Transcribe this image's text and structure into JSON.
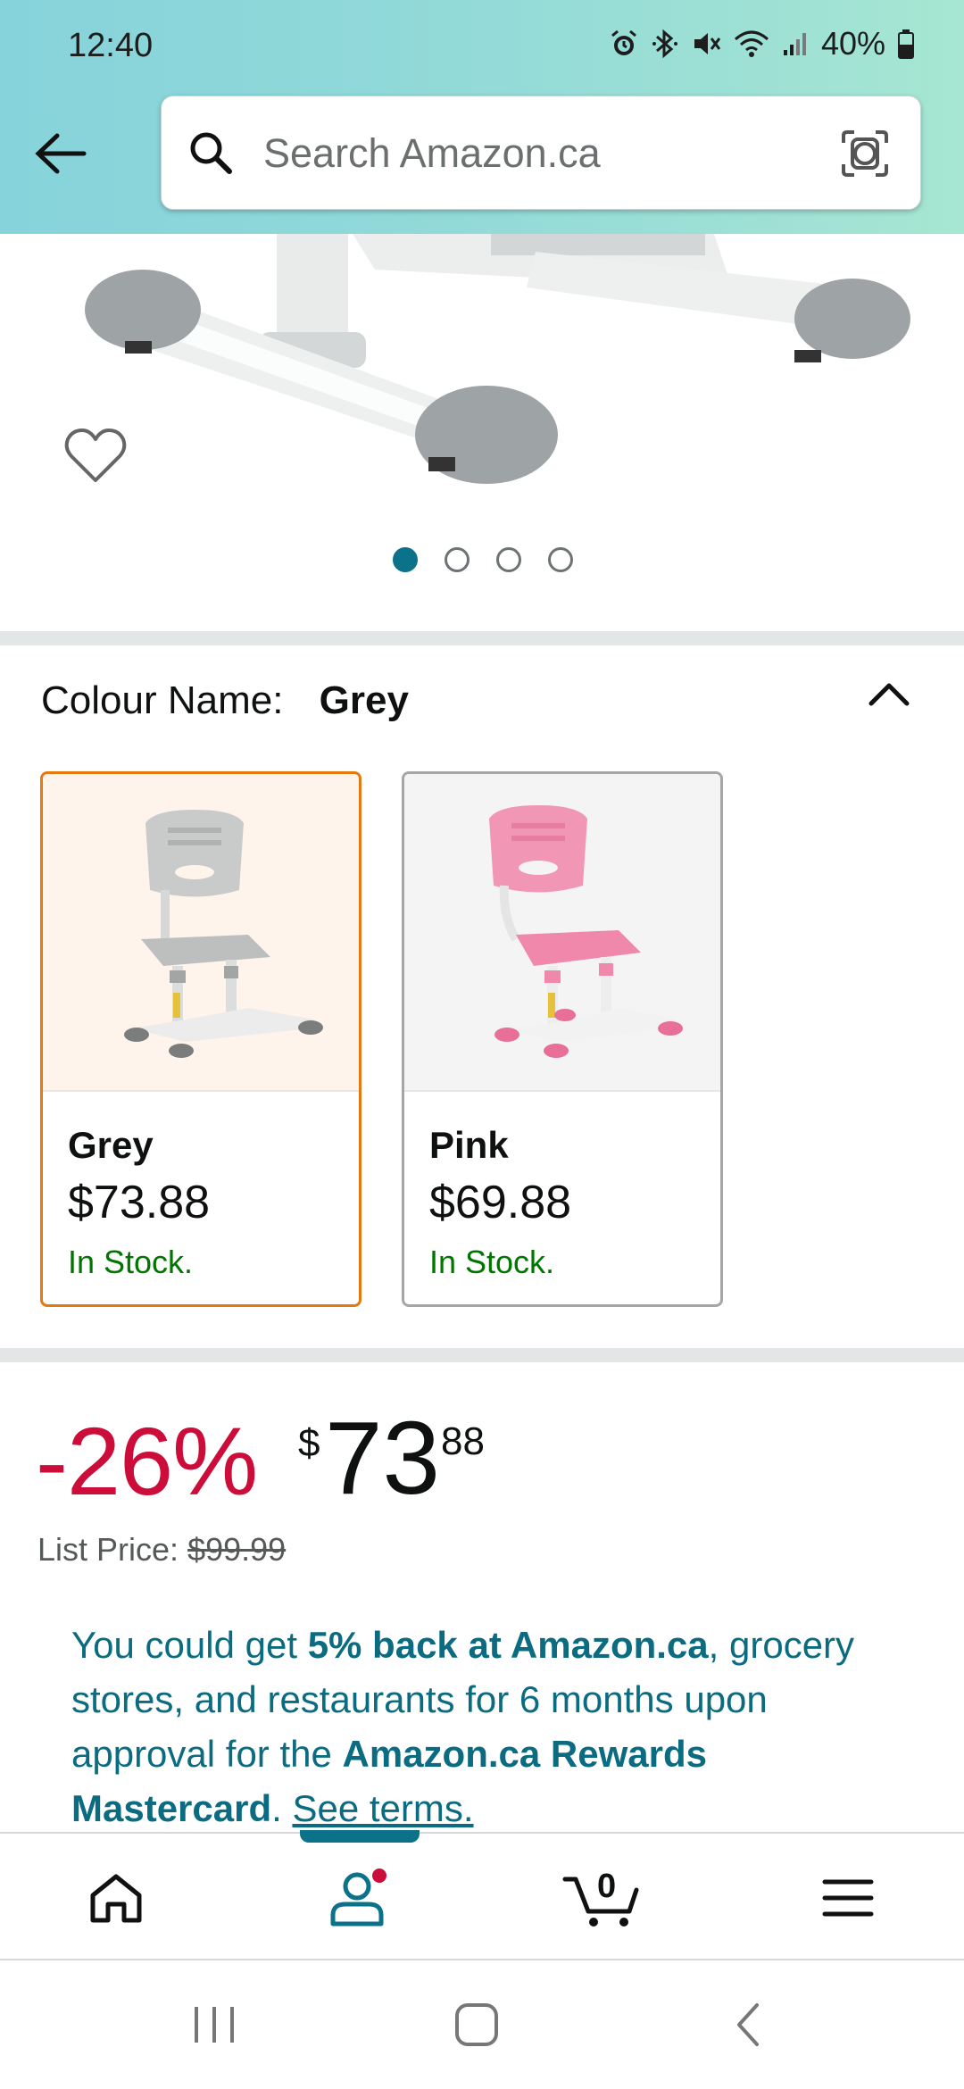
{
  "status_bar": {
    "time": "12:40",
    "battery": "40%"
  },
  "search": {
    "placeholder": "Search Amazon.ca"
  },
  "gallery": {
    "image_count": 4,
    "active_index": 0
  },
  "colour": {
    "label": "Colour Name:",
    "value": "Grey",
    "options": [
      {
        "name": "Grey",
        "price": "$73.88",
        "stock": "In Stock.",
        "selected": true,
        "color": "#c7c9c9"
      },
      {
        "name": "Pink",
        "price": "$69.88",
        "stock": "In Stock.",
        "selected": false,
        "color": "#f29ab8"
      }
    ]
  },
  "pricing": {
    "discount": "-26%",
    "currency": "$",
    "whole": "73",
    "fraction": "88",
    "list_price_label": "List Price:",
    "list_price_value": "$99.99"
  },
  "promo": {
    "text_1": "You could get ",
    "bold_1": "5% back at Amazon.ca",
    "text_2": ", grocery stores, and restaurants for 6 months upon approval for the ",
    "bold_2": "Amazon.ca Rewards Mastercard",
    "text_3": ". ",
    "link": "See terms."
  },
  "bottom_nav": {
    "cart_count": "0",
    "active": "account"
  },
  "colors": {
    "accent_teal": "#0b7289",
    "discount_red": "#cc0c39",
    "stock_green": "#007600",
    "selected_border": "#e47911"
  }
}
